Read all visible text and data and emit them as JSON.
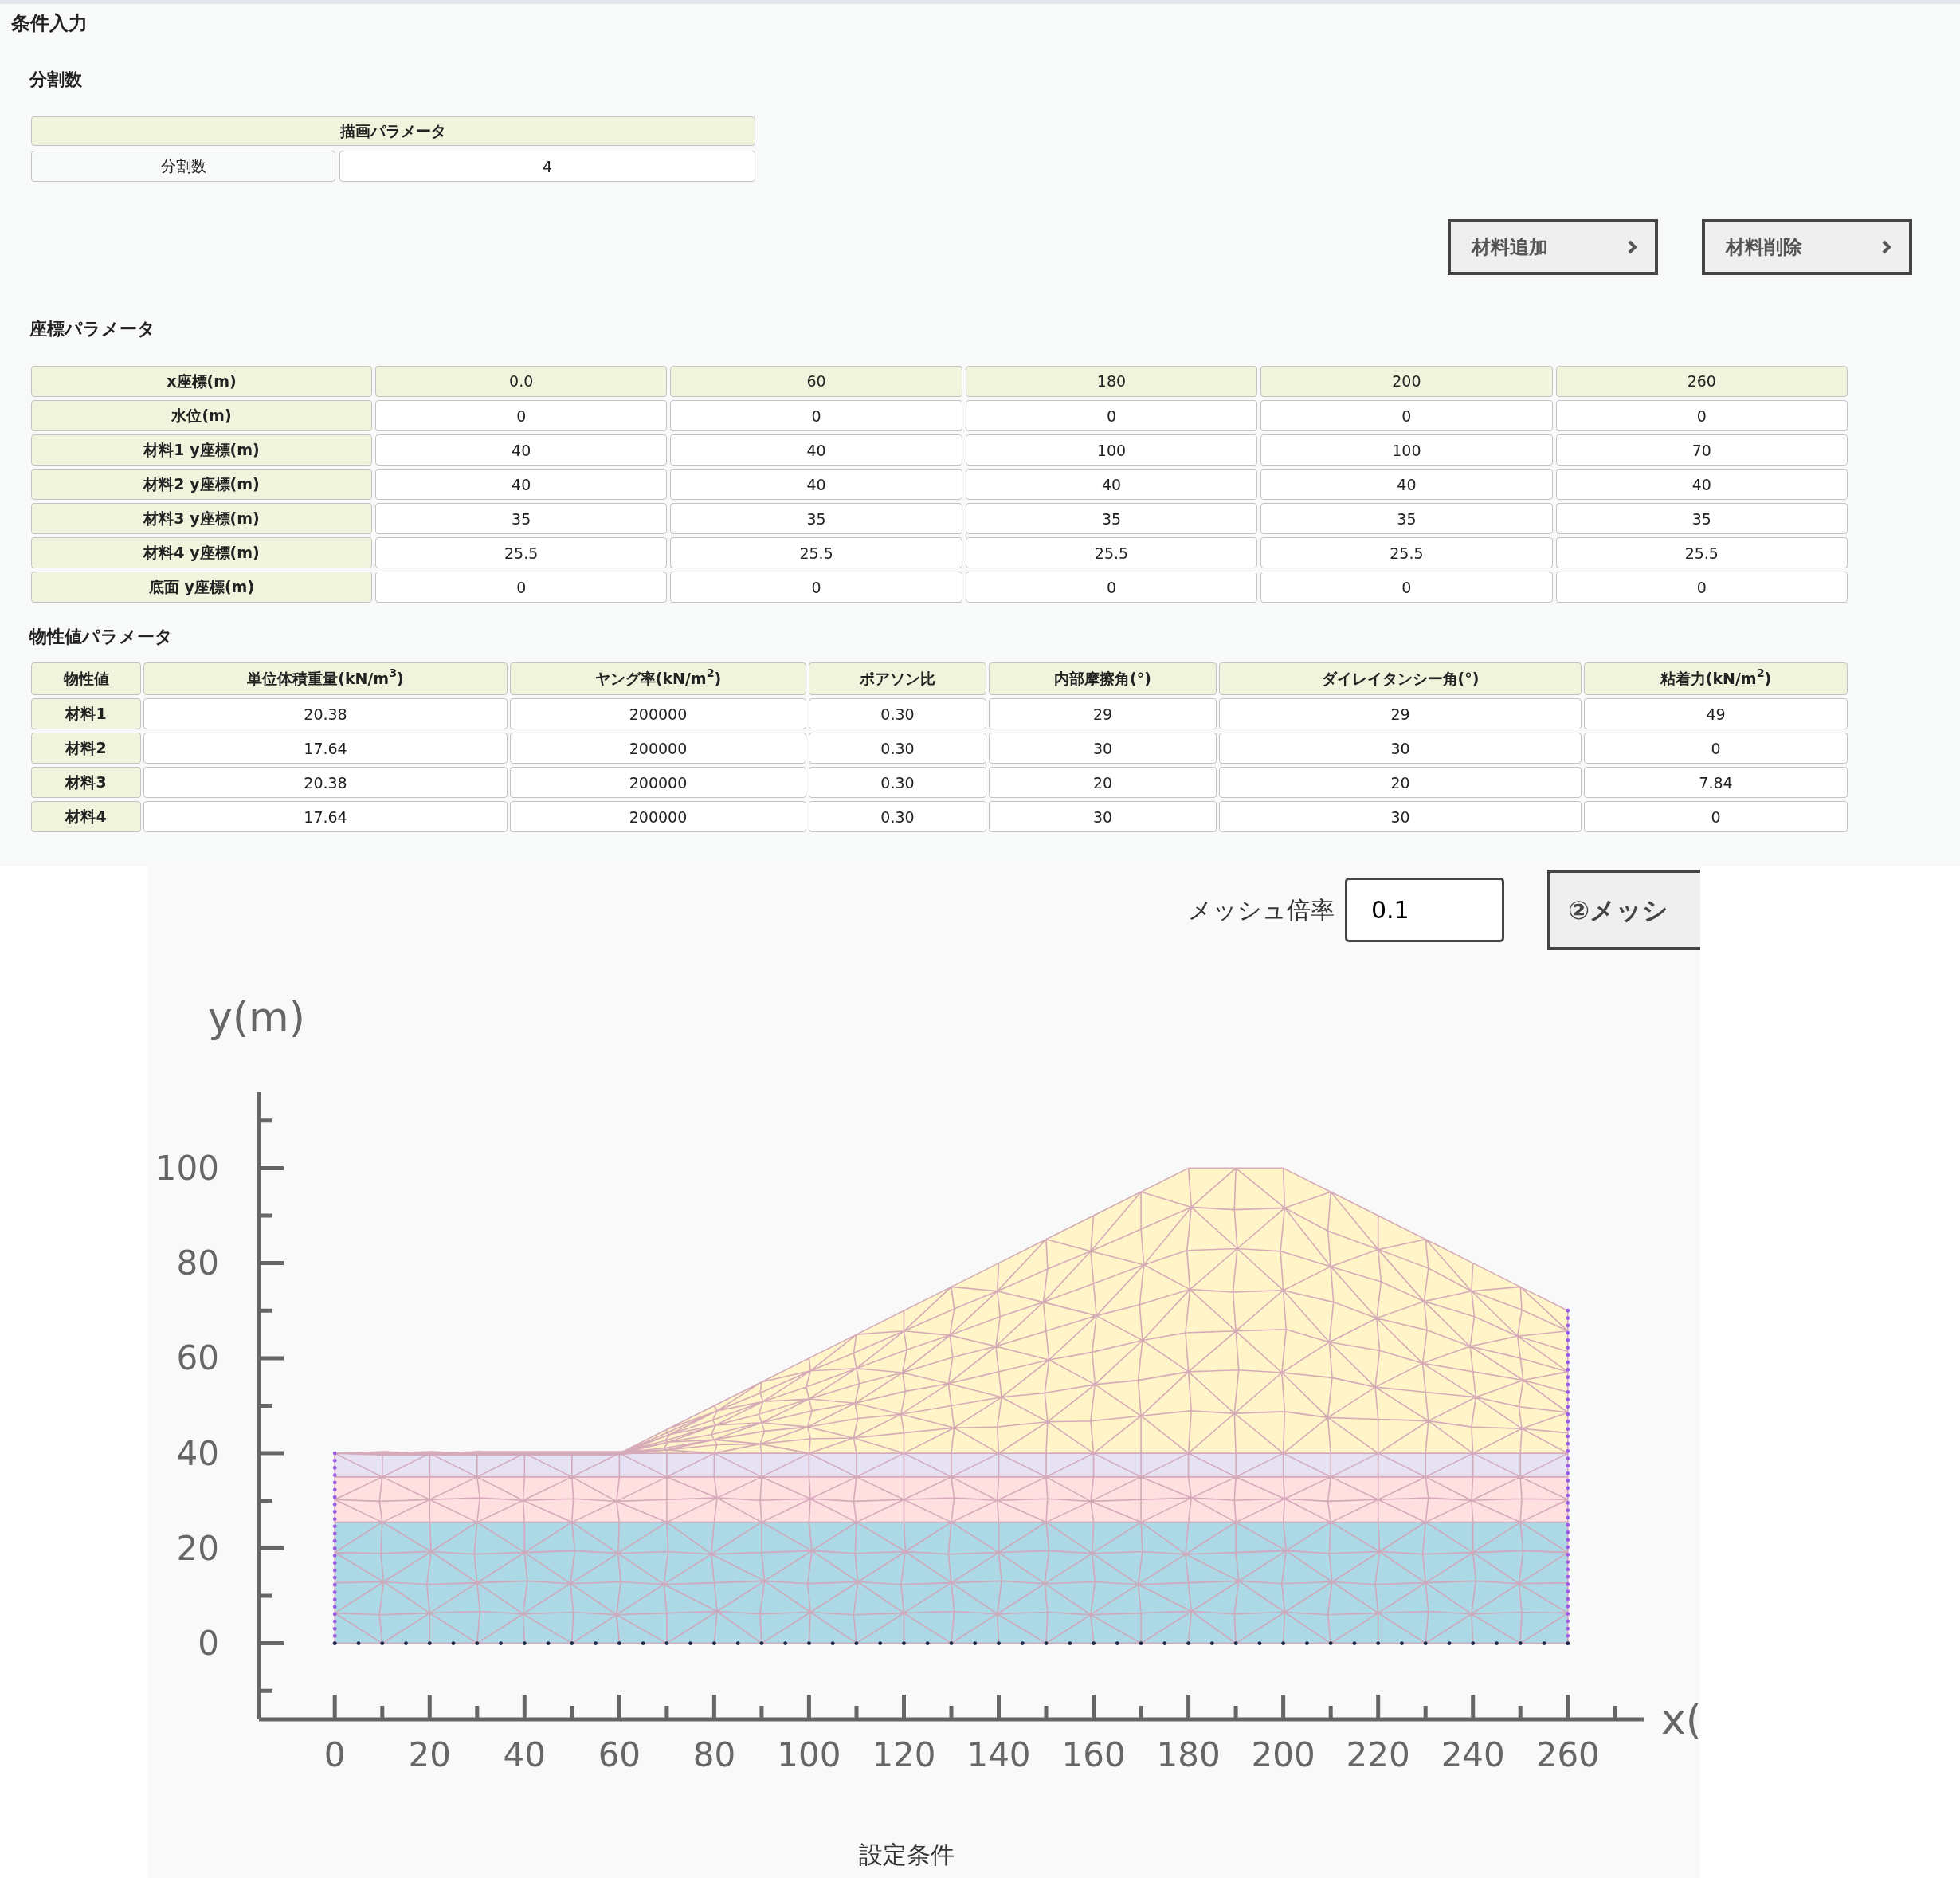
{
  "page_title": "条件入力",
  "division": {
    "heading": "分割数",
    "table_header": "描画パラメータ",
    "label": "分割数",
    "value": "4"
  },
  "material_buttons": [
    {
      "label": "材料追加"
    },
    {
      "label": "材料削除"
    }
  ],
  "coordinates": {
    "heading": "座標パラメータ",
    "x_row": {
      "label": "x座標(m)",
      "values": [
        "0.0",
        "60",
        "180",
        "200",
        "260"
      ]
    },
    "rows": [
      {
        "label": "水位(m)",
        "values": [
          "0",
          "0",
          "0",
          "0",
          "0"
        ]
      },
      {
        "label": "材料1 y座標(m)",
        "values": [
          "40",
          "40",
          "100",
          "100",
          "70"
        ]
      },
      {
        "label": "材料2 y座標(m)",
        "values": [
          "40",
          "40",
          "40",
          "40",
          "40"
        ]
      },
      {
        "label": "材料3 y座標(m)",
        "values": [
          "35",
          "35",
          "35",
          "35",
          "35"
        ]
      },
      {
        "label": "材料4 y座標(m)",
        "values": [
          "25.5",
          "25.5",
          "25.5",
          "25.5",
          "25.5"
        ]
      },
      {
        "label": "底面 y座標(m)",
        "values": [
          "0",
          "0",
          "0",
          "0",
          "0"
        ]
      }
    ]
  },
  "properties": {
    "heading": "物性値パラメータ",
    "columns": [
      "物性値",
      "単位体積重量(kN/m$^{3}$)",
      "ヤング率(kN/m$^{2}$)",
      "ポアソン比",
      "内部摩擦角(°)",
      "ダイレイタンシー角(°)",
      "粘着力(kN/m$^{2}$)"
    ],
    "rows": [
      {
        "label": "材料1",
        "values": [
          "20.38",
          "200000",
          "0.30",
          "29",
          "29",
          "49"
        ]
      },
      {
        "label": "材料2",
        "values": [
          "17.64",
          "200000",
          "0.30",
          "30",
          "30",
          "0"
        ]
      },
      {
        "label": "材料3",
        "values": [
          "20.38",
          "200000",
          "0.30",
          "20",
          "20",
          "7.84"
        ]
      },
      {
        "label": "材料4",
        "values": [
          "17.64",
          "200000",
          "0.30",
          "30",
          "30",
          "0"
        ]
      }
    ]
  },
  "mesh": {
    "label": "メッシュ倍率",
    "value": "0.1",
    "button": "②メッシ"
  },
  "chart": {
    "chart_data": {
      "type": "area",
      "title": "設定条件",
      "xlabel": "x(",
      "ylabel": "y(m)",
      "x": [
        0,
        60,
        180,
        200,
        260
      ],
      "series": [
        {
          "color": "#fff5c9",
          "values": [
            40,
            40,
            100,
            100,
            70
          ]
        },
        {
          "color": "#e7e1f4",
          "values": [
            40,
            40,
            40,
            40,
            40
          ]
        },
        {
          "color": "#fde0df",
          "values": [
            35,
            35,
            35,
            35,
            35
          ]
        },
        {
          "color": "#add8e6",
          "values": [
            25.5,
            25.5,
            25.5,
            25.5,
            25.5
          ]
        }
      ],
      "xlim": [
        -16,
        276
      ],
      "ylim": [
        -16,
        116
      ],
      "xticks": [
        0,
        20,
        40,
        60,
        80,
        100,
        120,
        140,
        160,
        180,
        200,
        220,
        240,
        260
      ],
      "yticks": [
        0,
        20,
        40,
        60,
        80,
        100
      ]
    }
  }
}
